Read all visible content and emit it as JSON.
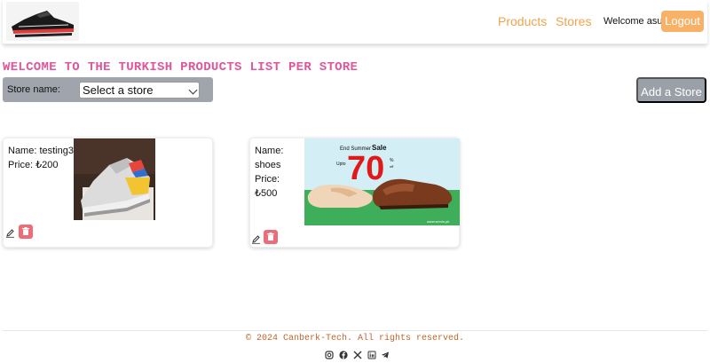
{
  "header": {
    "nav": {
      "products": "Products",
      "stores": "Stores"
    },
    "welcome": "Welcome asu",
    "logout": "Logout"
  },
  "page": {
    "title": "WELCOME TO THE TURKISH PRODUCTS LIST PER STORE"
  },
  "store_filter": {
    "label": "Store name:",
    "selected": "Select a store"
  },
  "add_store_label": "Add a Store",
  "products": [
    {
      "name": "Name: testing3",
      "price": "Price: ₺200"
    },
    {
      "name": "Name: shoes",
      "price": "Price: ₺500"
    }
  ],
  "promo": {
    "line1": "End Summer",
    "sale": "Sale",
    "upto": "Upto",
    "percent": "70",
    "pct_sign": "%",
    "off": "off",
    "site": "www.servis.pk"
  },
  "footer": {
    "copyright": "© 2024 Canberk-Tech. All rights reserved.",
    "socials": [
      "instagram-icon",
      "facebook-icon",
      "x-icon",
      "linkedin-icon",
      "telegram-icon"
    ]
  },
  "colors": {
    "accent": "#f0a44a",
    "title": "#e0569a",
    "delete": "#f06b78",
    "bar": "#a0a4ad"
  }
}
